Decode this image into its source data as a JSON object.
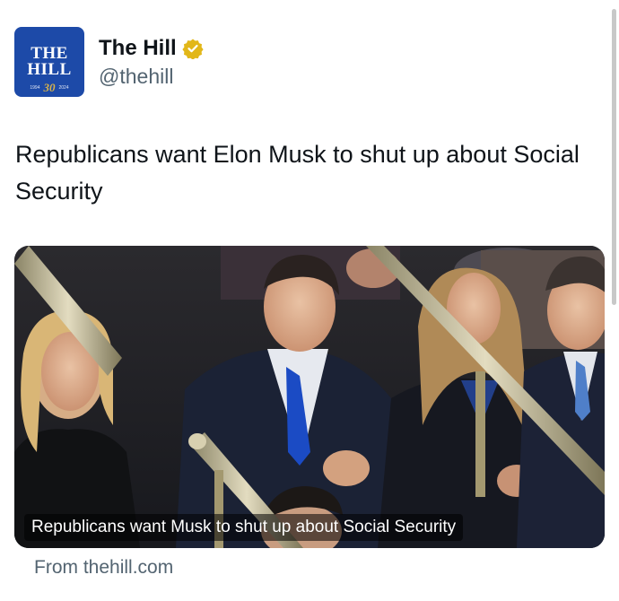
{
  "account": {
    "display_name": "The Hill",
    "handle": "@thehill",
    "avatar_logo_line1": "THE",
    "avatar_logo_line2": "HILL",
    "avatar_years_start": "1994",
    "avatar_years_end": "2024",
    "avatar_anniversary": "30",
    "verified": true,
    "badge_color": "#e2b719",
    "avatar_color": "#1d4aa8"
  },
  "post": {
    "text": "Republicans want Elon Musk to shut up about Social Security"
  },
  "card": {
    "caption": "Republicans want Musk to shut up about Social Security",
    "source": "From thehill.com"
  },
  "icons": {
    "verified": "verified-badge-icon"
  }
}
